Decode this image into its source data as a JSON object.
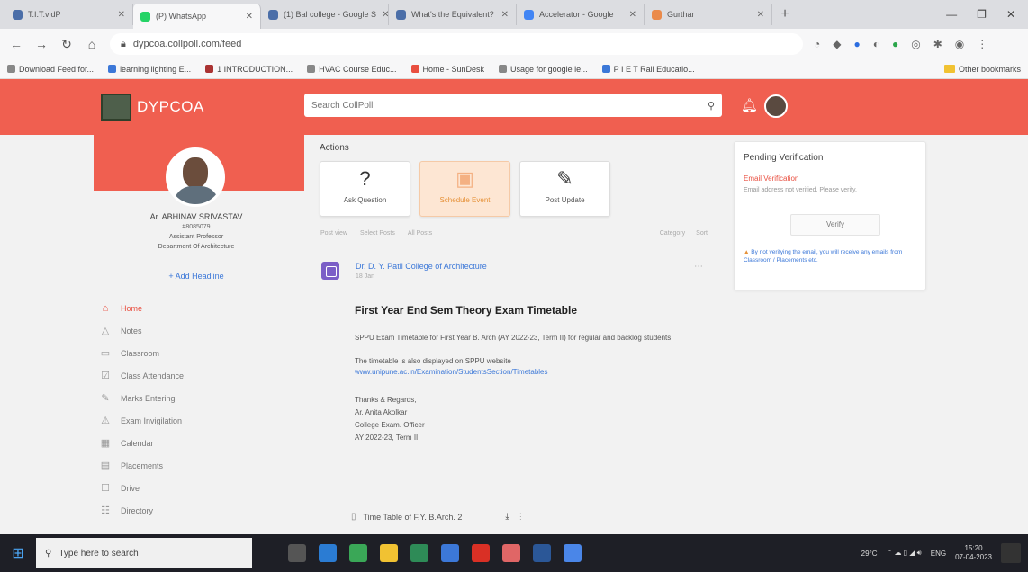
{
  "browser": {
    "tabs": [
      {
        "label": "T.I.T.vidP",
        "active": false
      },
      {
        "label": "(P) WhatsApp",
        "active": true
      },
      {
        "label": "(1) Bal college - Google S",
        "active": false
      },
      {
        "label": "What's the Equivalent?",
        "active": false
      },
      {
        "label": "Accelerator - Google",
        "active": false
      },
      {
        "label": "Gurthar",
        "active": false
      }
    ],
    "new_tab": "+",
    "window_controls": [
      "—",
      "❐",
      "✕"
    ],
    "url": "dypcoa.collpoll.com/feed",
    "bookmarks": [
      "Download Feed for...",
      "learning lighting E...",
      "1 INTRODUCTION...",
      "HVAC Course Educ...",
      "Home - SunDesk",
      "Usage for google le...",
      "P I E T Rail Educatio..."
    ],
    "other_bookmarks": "Other bookmarks"
  },
  "app": {
    "brand": "DYPCOA",
    "search_placeholder": "Search CollPoll",
    "accent": "#f05f50"
  },
  "profile": {
    "name": "Ar. ABHINAV SRIVASTAV",
    "id": "#8085079",
    "role": "Assistant Professor",
    "department": "Department Of Architecture",
    "add_headline": "+ Add Headline"
  },
  "nav": [
    {
      "label": "Home",
      "icon": "home-icon",
      "glyph": "⌂",
      "active": true
    },
    {
      "label": "Notes",
      "icon": "notes-icon",
      "glyph": "△",
      "active": false
    },
    {
      "label": "Classroom",
      "icon": "classroom-icon",
      "glyph": "▭",
      "active": false
    },
    {
      "label": "Class Attendance",
      "icon": "attendance-icon",
      "glyph": "☑",
      "active": false
    },
    {
      "label": "Marks Entering",
      "icon": "marks-icon",
      "glyph": "✎",
      "active": false
    },
    {
      "label": "Exam Invigilation",
      "icon": "exam-icon",
      "glyph": "⚠",
      "active": false
    },
    {
      "label": "Calendar",
      "icon": "calendar-icon",
      "glyph": "▦",
      "active": false
    },
    {
      "label": "Placements",
      "icon": "placements-icon",
      "glyph": "▤",
      "active": false
    },
    {
      "label": "Drive",
      "icon": "drive-icon",
      "glyph": "☐",
      "active": false
    },
    {
      "label": "Directory",
      "icon": "directory-icon",
      "glyph": "☷",
      "active": false
    }
  ],
  "actions": {
    "title": "Actions",
    "items": [
      {
        "label": "Ask Question",
        "icon": "question-icon",
        "glyph": "?",
        "highlight": false
      },
      {
        "label": "Schedule Event",
        "icon": "calendar-icon",
        "glyph": "▣",
        "highlight": true
      },
      {
        "label": "Post Update",
        "icon": "pencil-icon",
        "glyph": "✎",
        "highlight": false
      }
    ]
  },
  "filters": {
    "left": [
      "Post view",
      "Select Posts",
      "All Posts"
    ],
    "right": [
      "Category",
      "Sort"
    ]
  },
  "post": {
    "author": "Dr. D. Y. Patil College of Architecture",
    "time": "18 Jan",
    "title": "First Year End Sem Theory Exam Timetable",
    "body": "SPPU Exam Timetable for First Year B. Arch (AY 2022-23, Term II) for regular and backlog students.",
    "note": "The timetable is also displayed on SPPU website",
    "link": "www.unipune.ac.in/Examination/StudentsSection/Timetables",
    "signature": [
      "Thanks & Regards,",
      "Ar. Anita Akolkar",
      "College Exam. Officer",
      "AY 2022-23, Term II"
    ],
    "attachment": "Time Table of F.Y. B.Arch. 2"
  },
  "pending": {
    "title": "Pending Verification",
    "subtitle": "Email Verification",
    "message": "Email address not verified. Please verify.",
    "button": "Verify",
    "note": "By not verifying the email, you will receive any emails from Classroom / Placements etc."
  },
  "taskbar": {
    "search_placeholder": "Type here to search",
    "weather": "29°C",
    "time": "15:20",
    "date": "07-04-2023",
    "lang": "ENG"
  }
}
